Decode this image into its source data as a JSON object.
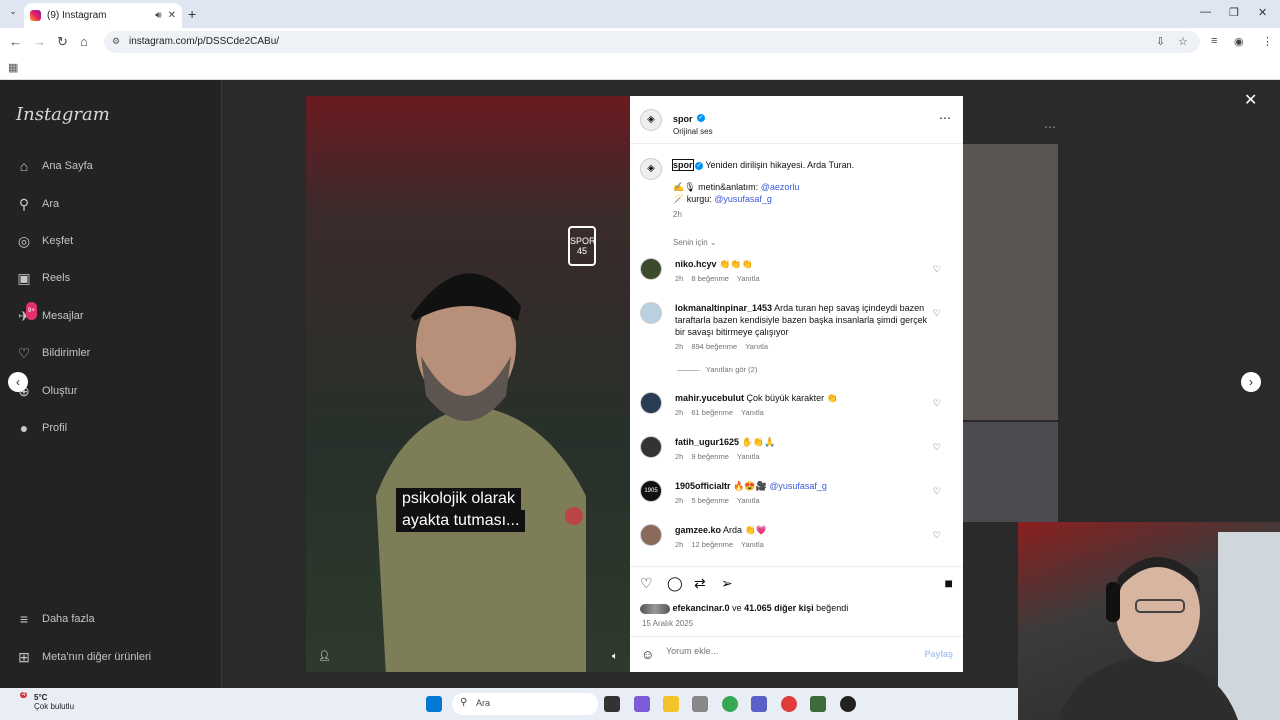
{
  "browser": {
    "tab_title": "(9) Instagram",
    "url": "instagram.com/p/DSSCde2CABu/",
    "new_tab_label": "+"
  },
  "sidebar": {
    "logo": "Instagram",
    "items": [
      {
        "label": "Ana Sayfa",
        "icon": "home-icon"
      },
      {
        "label": "Ara",
        "icon": "search-icon"
      },
      {
        "label": "Keşfet",
        "icon": "explore-icon"
      },
      {
        "label": "Reels",
        "icon": "reels-icon"
      },
      {
        "label": "Mesajlar",
        "icon": "messenger-icon",
        "badge": "9+"
      },
      {
        "label": "Bildirimler",
        "icon": "heart-icon"
      },
      {
        "label": "Oluştur",
        "icon": "plus-icon"
      },
      {
        "label": "Profil",
        "icon": "profile-icon"
      }
    ],
    "more": "Daha fazla",
    "meta_products": "Meta'nın diğer ürünleri"
  },
  "post": {
    "author": "spor",
    "audio": "Orijinal ses",
    "caption_author": "spor",
    "caption": "Yeniden dirilişin hikayesi. Arda Turan.",
    "credit1_prefix": "metin&anlatım:",
    "credit1_user": "@aezorlu",
    "credit2_prefix": "kurgu:",
    "credit2_user": "@yusufasaf_g",
    "time": "2h",
    "sort_label": "Senin için",
    "video_caption_line1": "psikolojik olarak",
    "video_caption_line2": "ayakta tutması...",
    "media_badge": "SPOR 45"
  },
  "comments": [
    {
      "user": "niko.hcyv",
      "text": "👏👏👏",
      "time": "2h",
      "likes": "8 beğenme",
      "reply": "Yanıtla"
    },
    {
      "user": "lokmanaltinpinar_1453",
      "text": "Arda turan hep savaş içindeydi bazen taraftarla bazen kendisiyle bazen başka insanlarla şimdi gerçek bir savaşı bitirmeye çalışıyor",
      "time": "2h",
      "likes": "894 beğenme",
      "reply": "Yanıtla",
      "view_replies": "Yanıtları gör (2)"
    },
    {
      "user": "mahir.yucebulut",
      "text": "Çok büyük karakter 👏",
      "time": "2h",
      "likes": "61 beğenme",
      "reply": "Yanıtla"
    },
    {
      "user": "fatih_ugur1625",
      "text": "✋👏🙏",
      "time": "2h",
      "likes": "9 beğenme",
      "reply": "Yanıtla"
    },
    {
      "user": "1905officialtr",
      "text": "🔥😍🎥",
      "mention": "@yusufasaf_g",
      "time": "2h",
      "likes": "5 beğenme",
      "reply": "Yanıtla"
    },
    {
      "user": "gamzee.ko",
      "text": "Arda 👏💗",
      "time": "2h",
      "likes": "12 beğenme",
      "reply": "Yanıtla"
    }
  ],
  "likes": {
    "user": "efekancinar.0",
    "middle": "ve",
    "others": "41.065 diğer kişi",
    "suffix": "beğendi",
    "date": "15 Aralık 2025"
  },
  "add_comment": {
    "placeholder": "Yorum ekle...",
    "post": "Paylaş"
  },
  "taskbar": {
    "temp": "5°C",
    "weather": "Çok bulutlu",
    "weather_badge": "4",
    "search": "Ara"
  },
  "colors": {
    "accent": "#0095f6",
    "link": "#3d5bd9",
    "badge": "#e1306c"
  }
}
